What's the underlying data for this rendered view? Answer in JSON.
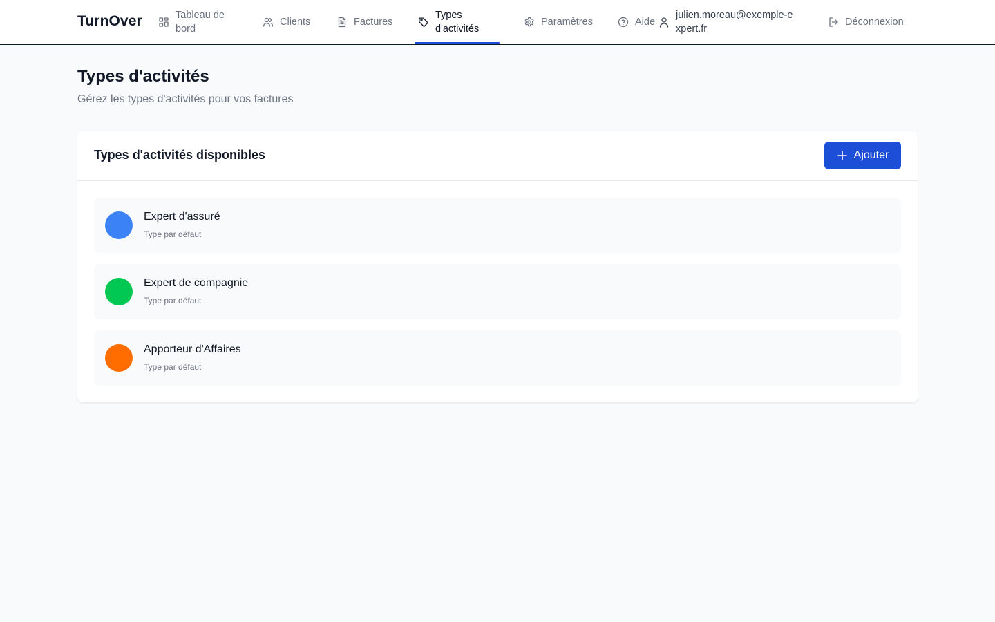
{
  "app": {
    "brand": "TurnOver"
  },
  "nav": {
    "items": [
      {
        "id": "dashboard",
        "label": "Tableau de bord",
        "icon": "grid-icon"
      },
      {
        "id": "clients",
        "label": "Clients",
        "icon": "users-icon"
      },
      {
        "id": "invoices",
        "label": "Factures",
        "icon": "document-icon"
      },
      {
        "id": "types",
        "label": "Types d'activités",
        "icon": "tag-icon",
        "active": true
      },
      {
        "id": "settings",
        "label": "Paramètres",
        "icon": "gear-icon"
      },
      {
        "id": "help",
        "label": "Aide",
        "icon": "help-circle-icon"
      }
    ],
    "user_email": "julien.moreau@exemple-expert.fr",
    "logout_label": "Déconnexion",
    "accent_color": "#1d4ed8"
  },
  "page": {
    "title": "Types d'activités",
    "subtitle": "Gérez les types d'activités pour vos factures"
  },
  "card": {
    "title": "Types d'activités disponibles",
    "add_label": "Ajouter",
    "add_button_color": "#1d4ed8",
    "types": [
      {
        "name": "Expert d'assuré",
        "description": "Type par défaut",
        "color": "#3b82f6"
      },
      {
        "name": "Expert de compagnie",
        "description": "Type par défaut",
        "color": "#00c853"
      },
      {
        "name": "Apporteur d'Affaires",
        "description": "Type par défaut",
        "color": "#ff6d00"
      }
    ]
  }
}
